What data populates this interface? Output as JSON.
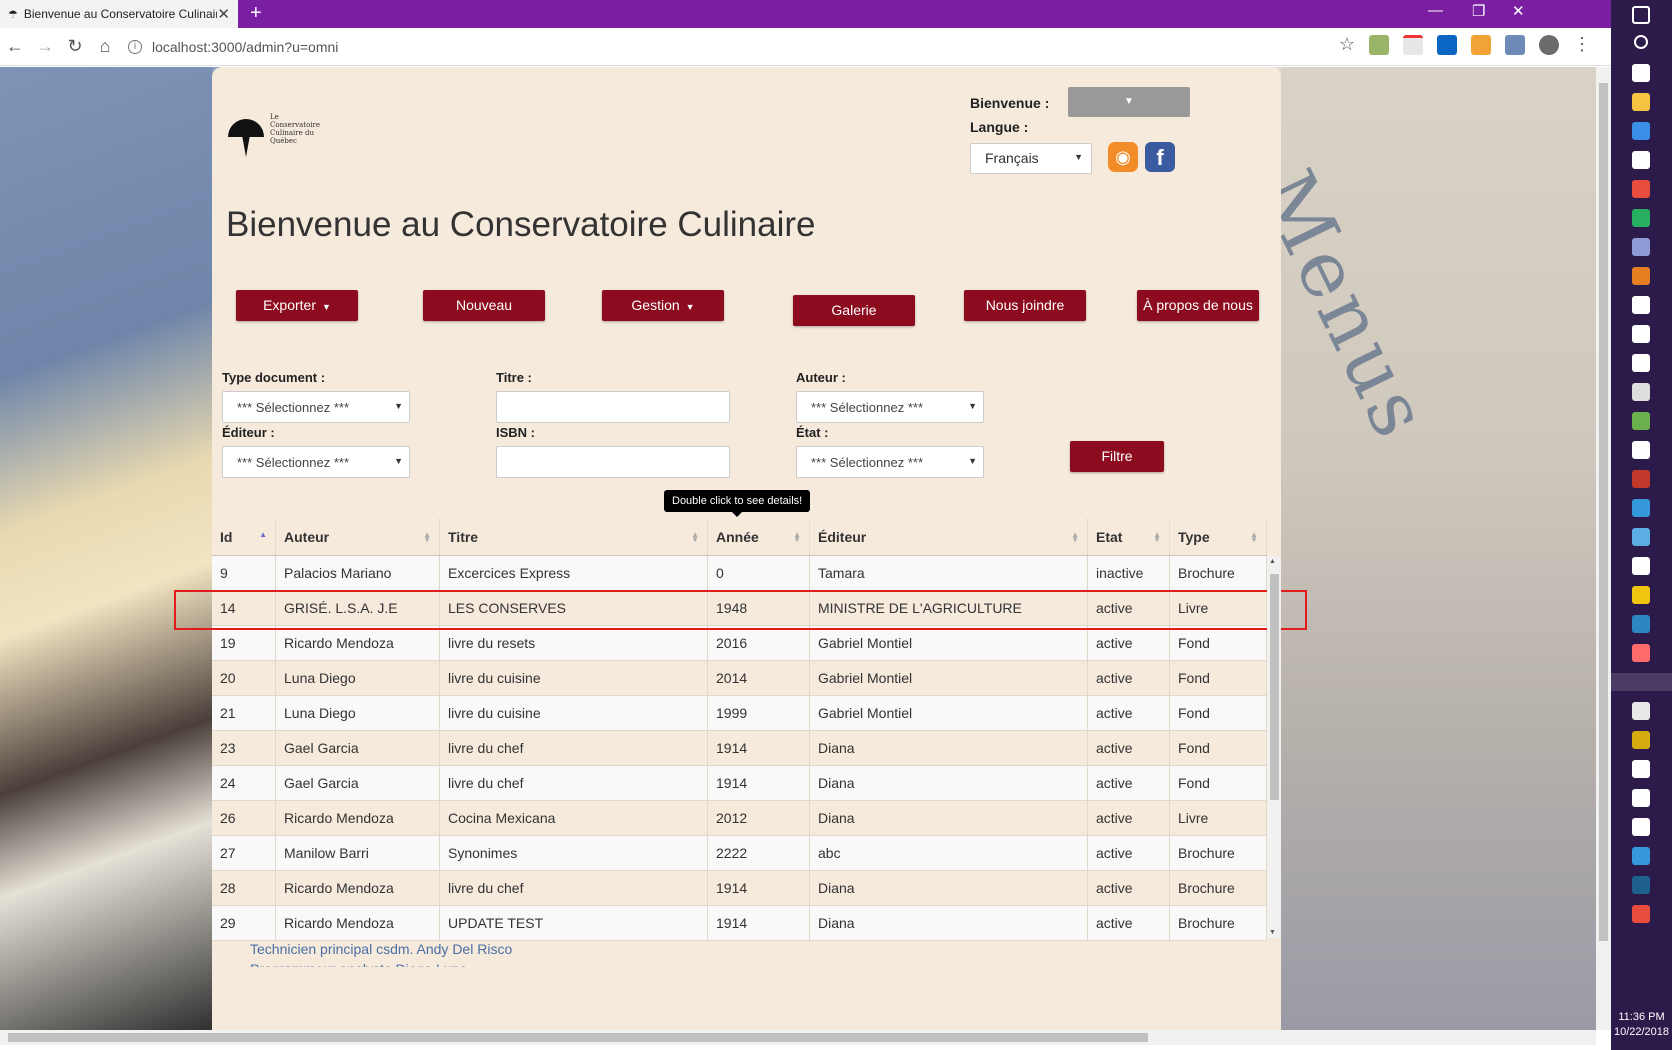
{
  "browser": {
    "tab_title": "Bienvenue au Conservatoire Culinaire",
    "tab_close": "✕",
    "new_tab": "+",
    "url": "localhost:3000/admin?u=omni"
  },
  "header": {
    "logo_text": "Le Conservatoire Culinaire du Québec",
    "welcome_label": "Bienvenue :",
    "language_label": "Langue :",
    "language_value": "Français",
    "title": "Bienvenue au Conservatoire Culinaire"
  },
  "nav": {
    "export": "Exporter",
    "new": "Nouveau",
    "manage": "Gestion",
    "gallery": "Galerie",
    "contact": "Nous joindre",
    "about": "À propos de nous"
  },
  "filters": {
    "type_label": "Type document :",
    "type_value": "*** Sélectionnez ***",
    "title_label": "Titre :",
    "author_label": "Auteur :",
    "author_value": "*** Sélectionnez ***",
    "editor_label": "Éditeur :",
    "editor_value": "*** Sélectionnez ***",
    "isbn_label": "ISBN :",
    "state_label": "État :",
    "state_value": "*** Sélectionnez ***",
    "filter_button": "Filtre"
  },
  "tooltip": "Double click to see details!",
  "table": {
    "columns": [
      "Id",
      "Auteur",
      "Titre",
      "Année",
      "Éditeur",
      "Etat",
      "Type"
    ],
    "rows": [
      [
        "9",
        "Palacios Mariano",
        "Excercices Express",
        "0",
        "Tamara",
        "inactive",
        "Brochure"
      ],
      [
        "14",
        "GRISÉ. L.S.A. J.E",
        "LES CONSERVES",
        "1948",
        "MINISTRE DE L'AGRICULTURE",
        "active",
        "Livre"
      ],
      [
        "19",
        "Ricardo Mendoza",
        "livre du resets",
        "2016",
        "Gabriel Montiel",
        "active",
        "Fond"
      ],
      [
        "20",
        "Luna Diego",
        "livre du cuisine",
        "2014",
        "Gabriel Montiel",
        "active",
        "Fond"
      ],
      [
        "21",
        "Luna Diego",
        "livre du cuisine",
        "1999",
        "Gabriel Montiel",
        "active",
        "Fond"
      ],
      [
        "23",
        "Gael Garcia",
        "livre du chef",
        "1914",
        "Diana",
        "active",
        "Fond"
      ],
      [
        "24",
        "Gael Garcia",
        "livre du chef",
        "1914",
        "Diana",
        "active",
        "Fond"
      ],
      [
        "26",
        "Ricardo Mendoza",
        "Cocina Mexicana",
        "2012",
        "Diana",
        "active",
        "Livre"
      ],
      [
        "27",
        "Manilow Barri",
        "Synonimes",
        "2222",
        "abc",
        "active",
        "Brochure"
      ],
      [
        "28",
        "Ricardo Mendoza",
        "livre du chef",
        "1914",
        "Diana",
        "active",
        "Brochure"
      ],
      [
        "29",
        "Ricardo Mendoza",
        "UPDATE TEST",
        "1914",
        "Diana",
        "active",
        "Brochure"
      ]
    ],
    "highlighted_row_id": "14",
    "sorted_column": "Id"
  },
  "footer": {
    "credit": "Technicien principal csdm. Andy Del Risco",
    "credit2": "Programmeur analyste Diego Luna"
  },
  "taskbar": {
    "time": "11:36 PM",
    "date": "10/22/2018"
  },
  "colors": {
    "accent": "#8c0b1e",
    "panel_bg": "#f5eadc",
    "tabbar": "#7a1fa2",
    "highlight": "#e21b1b",
    "taskbar": "#2b1a4a"
  }
}
